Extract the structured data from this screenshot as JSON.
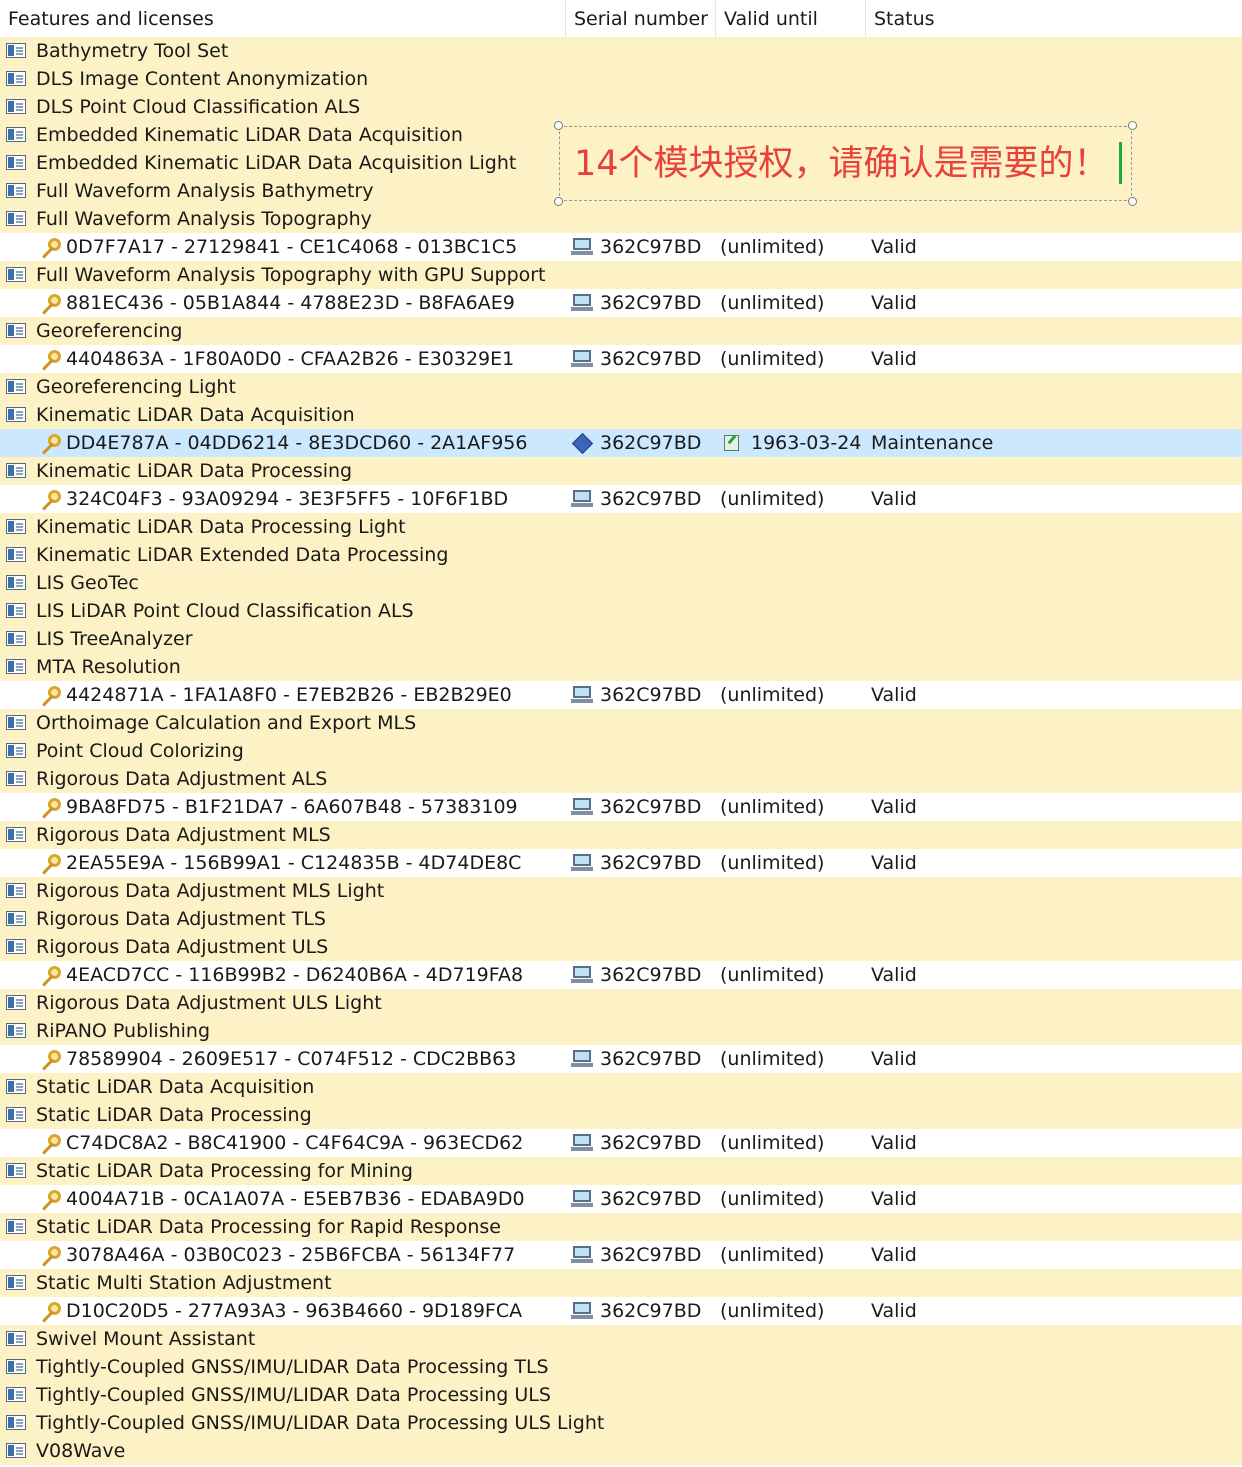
{
  "columns": {
    "features": "Features and licenses",
    "serial": "Serial number",
    "valid": "Valid until",
    "status": "Status"
  },
  "annotation": {
    "text": "14个模块授权，请确认是需要的！",
    "color": "#e8413a"
  },
  "colors": {
    "feature_row": "#fdf2c5",
    "selected_row": "#cce8ff"
  },
  "rows": [
    {
      "type": "feature",
      "name": "Bathymetry Tool Set"
    },
    {
      "type": "feature",
      "name": "DLS Image Content Anonymization"
    },
    {
      "type": "feature",
      "name": "DLS Point Cloud Classification ALS"
    },
    {
      "type": "feature",
      "name": "Embedded Kinematic LiDAR Data Acquisition"
    },
    {
      "type": "feature",
      "name": "Embedded Kinematic LiDAR Data Acquisition Light"
    },
    {
      "type": "feature",
      "name": "Full Waveform Analysis Bathymetry"
    },
    {
      "type": "feature",
      "name": "Full Waveform Analysis Topography"
    },
    {
      "type": "license",
      "key": "0D7F7A17 - 27129841 - CE1C4068 - 013BC1C5",
      "serial_icon": "computer-icon",
      "serial": "362C97BD",
      "valid": "(unlimited)",
      "status": "Valid"
    },
    {
      "type": "feature",
      "name": "Full Waveform Analysis Topography with GPU Support"
    },
    {
      "type": "license",
      "key": "881EC436 - 05B1A844 - 4788E23D - B8FA6AE9",
      "serial_icon": "computer-icon",
      "serial": "362C97BD",
      "valid": "(unlimited)",
      "status": "Valid"
    },
    {
      "type": "feature",
      "name": "Georeferencing"
    },
    {
      "type": "license",
      "key": "4404863A - 1F80A0D0 - CFAA2B26 - E30329E1",
      "serial_icon": "computer-icon",
      "serial": "362C97BD",
      "valid": "(unlimited)",
      "status": "Valid"
    },
    {
      "type": "feature",
      "name": "Georeferencing Light"
    },
    {
      "type": "feature",
      "name": "Kinematic LiDAR Data Acquisition"
    },
    {
      "type": "license",
      "selected": true,
      "key": "DD4E787A - 04DD6214 - 8E3DCD60 - 2A1AF956",
      "serial_icon": "dongle-icon",
      "serial": "362C97BD",
      "valid_icon": "certificate-icon",
      "valid": "1963-03-24",
      "status": "Maintenance"
    },
    {
      "type": "feature",
      "name": "Kinematic LiDAR Data Processing"
    },
    {
      "type": "license",
      "key": "324C04F3 - 93A09294 - 3E3F5FF5 - 10F6F1BD",
      "serial_icon": "computer-icon",
      "serial": "362C97BD",
      "valid": "(unlimited)",
      "status": "Valid"
    },
    {
      "type": "feature",
      "name": "Kinematic LiDAR Data Processing Light"
    },
    {
      "type": "feature",
      "name": "Kinematic LiDAR Extended Data Processing"
    },
    {
      "type": "feature",
      "name": "LIS GeoTec"
    },
    {
      "type": "feature",
      "name": "LIS LiDAR Point Cloud Classification ALS"
    },
    {
      "type": "feature",
      "name": "LIS TreeAnalyzer"
    },
    {
      "type": "feature",
      "name": "MTA Resolution"
    },
    {
      "type": "license",
      "key": "4424871A - 1FA1A8F0 - E7EB2B26 - EB2B29E0",
      "serial_icon": "computer-icon",
      "serial": "362C97BD",
      "valid": "(unlimited)",
      "status": "Valid"
    },
    {
      "type": "feature",
      "name": "Orthoimage Calculation and Export MLS"
    },
    {
      "type": "feature",
      "name": "Point Cloud Colorizing"
    },
    {
      "type": "feature",
      "name": "Rigorous Data Adjustment ALS"
    },
    {
      "type": "license",
      "key": "9BA8FD75 - B1F21DA7 - 6A607B48 - 57383109",
      "serial_icon": "computer-icon",
      "serial": "362C97BD",
      "valid": "(unlimited)",
      "status": "Valid"
    },
    {
      "type": "feature",
      "name": "Rigorous Data Adjustment MLS"
    },
    {
      "type": "license",
      "key": "2EA55E9A - 156B99A1 - C124835B - 4D74DE8C",
      "serial_icon": "computer-icon",
      "serial": "362C97BD",
      "valid": "(unlimited)",
      "status": "Valid"
    },
    {
      "type": "feature",
      "name": "Rigorous Data Adjustment MLS Light"
    },
    {
      "type": "feature",
      "name": "Rigorous Data Adjustment TLS"
    },
    {
      "type": "feature",
      "name": "Rigorous Data Adjustment ULS"
    },
    {
      "type": "license",
      "key": "4EACD7CC - 116B99B2 - D6240B6A - 4D719FA8",
      "serial_icon": "computer-icon",
      "serial": "362C97BD",
      "valid": "(unlimited)",
      "status": "Valid"
    },
    {
      "type": "feature",
      "name": "Rigorous Data Adjustment ULS Light"
    },
    {
      "type": "feature",
      "name": "RiPANO Publishing"
    },
    {
      "type": "license",
      "key": "78589904 - 2609E517 - C074F512 - CDC2BB63",
      "serial_icon": "computer-icon",
      "serial": "362C97BD",
      "valid": "(unlimited)",
      "status": "Valid"
    },
    {
      "type": "feature",
      "name": "Static LiDAR Data Acquisition"
    },
    {
      "type": "feature",
      "name": "Static LiDAR Data Processing"
    },
    {
      "type": "license",
      "key": "C74DC8A2 - B8C41900 - C4F64C9A - 963ECD62",
      "serial_icon": "computer-icon",
      "serial": "362C97BD",
      "valid": "(unlimited)",
      "status": "Valid"
    },
    {
      "type": "feature",
      "name": "Static LiDAR Data Processing for Mining"
    },
    {
      "type": "license",
      "key": "4004A71B - 0CA1A07A - E5EB7B36 - EDABA9D0",
      "serial_icon": "computer-icon",
      "serial": "362C97BD",
      "valid": "(unlimited)",
      "status": "Valid"
    },
    {
      "type": "feature",
      "name": "Static LiDAR Data Processing for Rapid Response"
    },
    {
      "type": "license",
      "key": "3078A46A - 03B0C023 - 25B6FCBA - 56134F77",
      "serial_icon": "computer-icon",
      "serial": "362C97BD",
      "valid": "(unlimited)",
      "status": "Valid"
    },
    {
      "type": "feature",
      "name": "Static Multi Station Adjustment"
    },
    {
      "type": "license",
      "key": "D10C20D5 - 277A93A3 - 963B4660 - 9D189FCA",
      "serial_icon": "computer-icon",
      "serial": "362C97BD",
      "valid": "(unlimited)",
      "status": "Valid"
    },
    {
      "type": "feature",
      "name": "Swivel Mount Assistant"
    },
    {
      "type": "feature",
      "name": "Tightly-Coupled GNSS/IMU/LIDAR Data Processing TLS"
    },
    {
      "type": "feature",
      "name": "Tightly-Coupled GNSS/IMU/LIDAR Data Processing ULS"
    },
    {
      "type": "feature",
      "name": "Tightly-Coupled GNSS/IMU/LIDAR Data Processing ULS Light"
    },
    {
      "type": "feature",
      "name": "V08Wave"
    }
  ]
}
